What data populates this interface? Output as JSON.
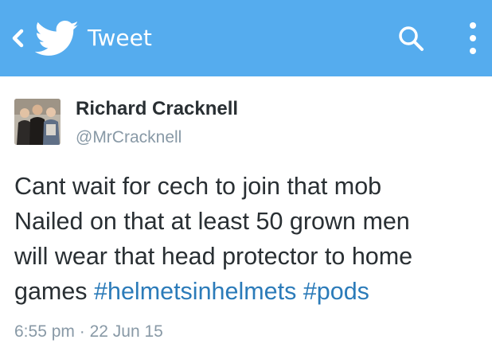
{
  "colors": {
    "header_background": "#55acee",
    "header_foreground": "#ffffff",
    "text_primary": "#292f33",
    "text_secondary": "#8899a6",
    "hashtag": "#2b7bb9"
  },
  "header": {
    "title": "Tweet",
    "icons": [
      "chevron-left-icon",
      "twitter-bird-icon",
      "search-icon",
      "more-vertical-icon"
    ]
  },
  "tweet": {
    "author": {
      "display_name": "Richard Cracknell",
      "handle": "@MrCracknell"
    },
    "text_lines": [
      "Cant wait for cech to join that mob",
      "Nailed on that at least 50 grown men",
      "will wear that head protector to home",
      "games"
    ],
    "hashtags": [
      "#helmetsinhelmets",
      "#pods"
    ],
    "time": "6:55 pm",
    "separator": "·",
    "date": "22 Jun 15"
  }
}
